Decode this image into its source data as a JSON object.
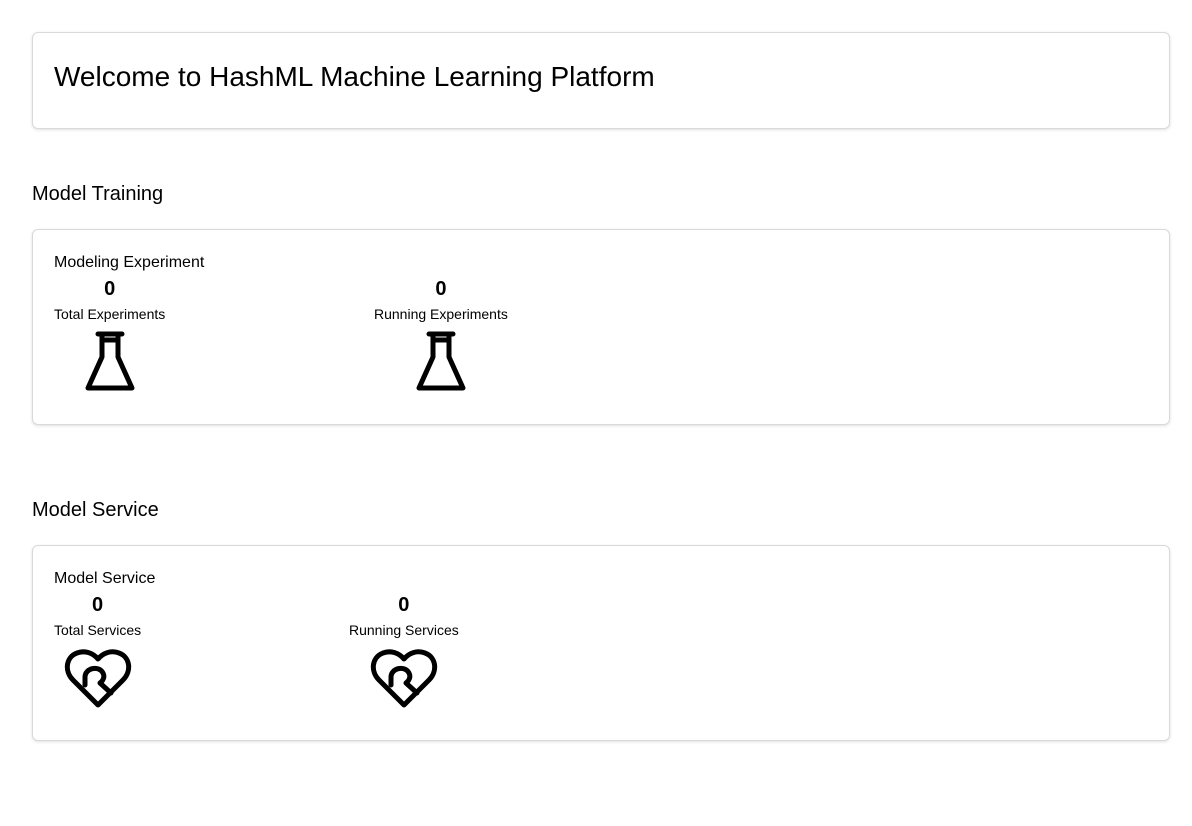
{
  "welcome": {
    "title": "Welcome to HashML Machine Learning Platform"
  },
  "training": {
    "heading": "Model Training",
    "card_title": "Modeling Experiment",
    "stats": [
      {
        "value": "0",
        "label": "Total Experiments",
        "icon": "flask-icon"
      },
      {
        "value": "0",
        "label": "Running Experiments",
        "icon": "flask-icon"
      }
    ]
  },
  "service": {
    "heading": "Model Service",
    "card_title": "Model Service",
    "stats": [
      {
        "value": "0",
        "label": "Total Services",
        "icon": "heart-link-icon"
      },
      {
        "value": "0",
        "label": "Running Services",
        "icon": "heart-link-icon"
      }
    ]
  }
}
